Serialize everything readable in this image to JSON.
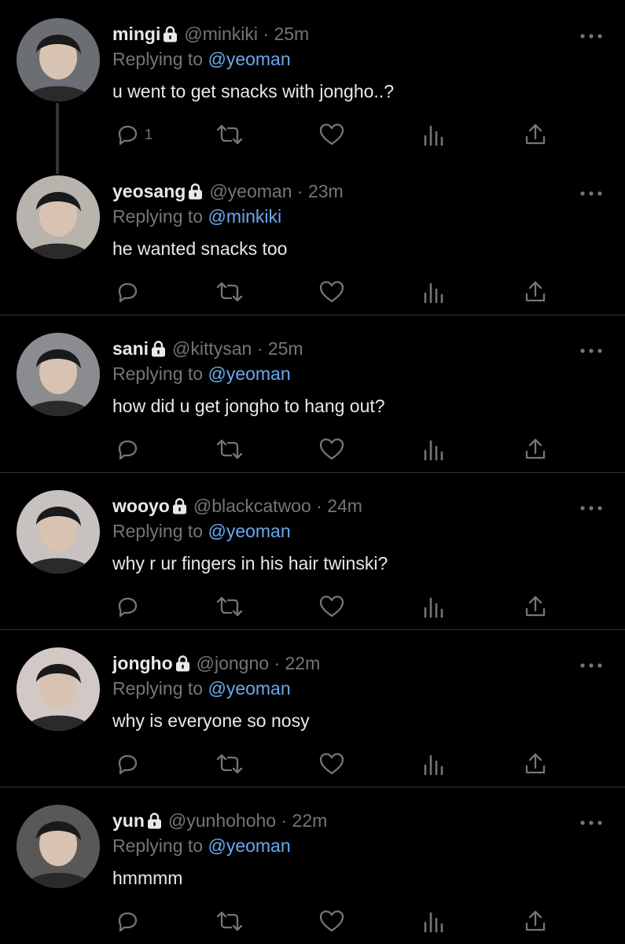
{
  "tweets": [
    {
      "name": "mingi",
      "handle": "@minkiki",
      "time": "25m",
      "replying_label": "Replying to",
      "replying_to": "@yeoman",
      "text": "u went to get snacks with jongho..?",
      "reply_count": "1",
      "thread": true,
      "avatar_bg": "#6b6e72"
    },
    {
      "name": "yeosang",
      "handle": "@yeoman",
      "time": "23m",
      "replying_label": "Replying to",
      "replying_to": "@minkiki",
      "text": "he wanted snacks too",
      "reply_count": "",
      "thread": false,
      "avatar_bg": "#b9b3ad"
    },
    {
      "name": "sani",
      "handle": "@kittysan",
      "time": "25m",
      "replying_label": "Replying to",
      "replying_to": "@yeoman",
      "text": "how did u get jongho to hang out?",
      "reply_count": "",
      "thread": false,
      "avatar_bg": "#8a8c8f"
    },
    {
      "name": "wooyo",
      "handle": "@blackcatwoo",
      "time": "24m",
      "replying_label": "Replying to",
      "replying_to": "@yeoman",
      "text": "why r ur fingers in his hair twinski?",
      "reply_count": "",
      "thread": false,
      "avatar_bg": "#c7c2bf"
    },
    {
      "name": "jongho",
      "handle": "@jongno",
      "time": "22m",
      "replying_label": "Replying to",
      "replying_to": "@yeoman",
      "text": "why is everyone so nosy",
      "reply_count": "",
      "thread": false,
      "avatar_bg": "#d2c9c6"
    },
    {
      "name": "yun",
      "handle": "@yunhohoho",
      "time": "22m",
      "replying_label": "Replying to",
      "replying_to": "@yeoman",
      "text": "hmmmm",
      "reply_count": "",
      "thread": false,
      "avatar_bg": "#5a5856"
    }
  ],
  "separator": "·",
  "icons": {
    "reply": "reply-icon",
    "retweet": "retweet-icon",
    "like": "heart-icon",
    "views": "views-icon",
    "share": "share-icon",
    "more": "more-icon",
    "lock": "lock-icon"
  },
  "colors": {
    "background": "#000000",
    "text": "#e7e9ea",
    "muted": "#71767b",
    "mention": "#6aa9ee",
    "divider": "#2f3336"
  }
}
